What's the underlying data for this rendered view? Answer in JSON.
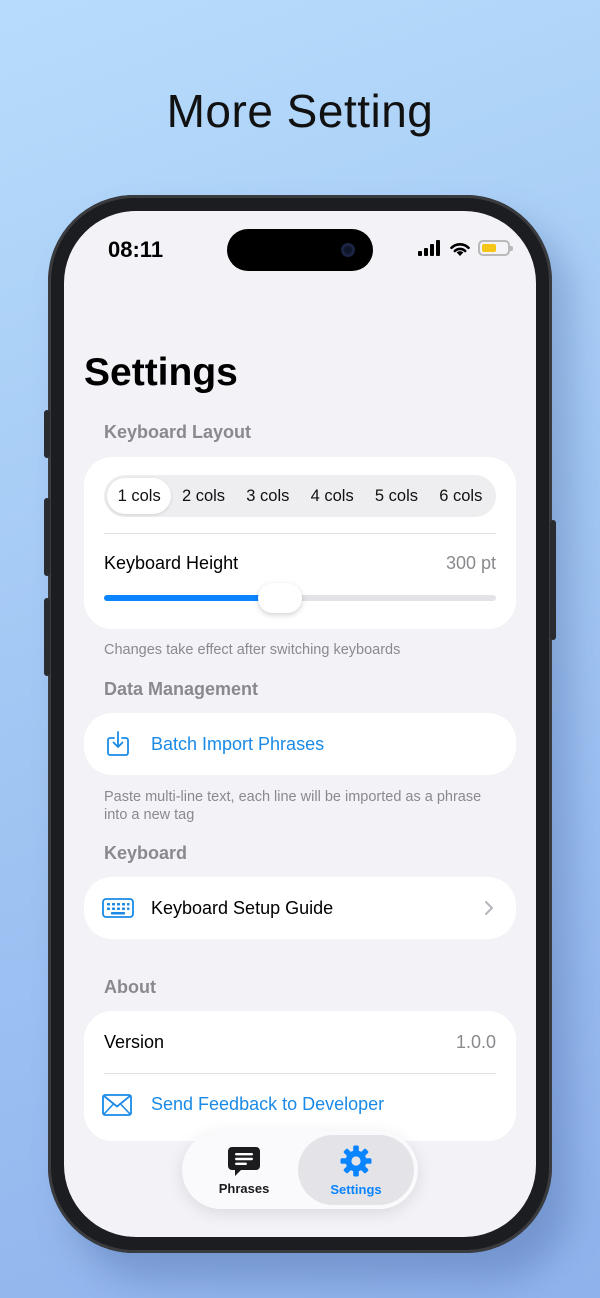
{
  "promo": {
    "title": "More Setting"
  },
  "status_bar": {
    "time": "08:11"
  },
  "page": {
    "title": "Settings"
  },
  "sections": {
    "keyboard_layout": {
      "header": "Keyboard Layout",
      "columns": [
        {
          "label": "1 cols",
          "selected": true
        },
        {
          "label": "2 cols",
          "selected": false
        },
        {
          "label": "3 cols",
          "selected": false
        },
        {
          "label": "4 cols",
          "selected": false
        },
        {
          "label": "5 cols",
          "selected": false
        },
        {
          "label": "6 cols",
          "selected": false
        }
      ],
      "height_label": "Keyboard Height",
      "height_value": "300 pt",
      "slider_fraction": 0.45,
      "footnote": "Changes take effect after switching keyboards"
    },
    "data_management": {
      "header": "Data Management",
      "batch_import_label": "Batch Import Phrases",
      "footnote": "Paste multi-line text, each line will be imported as a phrase into a new tag"
    },
    "keyboard": {
      "header": "Keyboard",
      "setup_guide_label": "Keyboard Setup Guide"
    },
    "about": {
      "header": "About",
      "version_label": "Version",
      "version_value": "1.0.0",
      "feedback_label": "Send Feedback to Developer"
    }
  },
  "tab_bar": {
    "tabs": [
      {
        "label": "Phrases",
        "icon": "message-icon",
        "active": false
      },
      {
        "label": "Settings",
        "icon": "gear-icon",
        "active": true
      }
    ]
  },
  "colors": {
    "accent": "#0a84ff",
    "link": "#1a8ae6",
    "battery": "#f5c518"
  }
}
